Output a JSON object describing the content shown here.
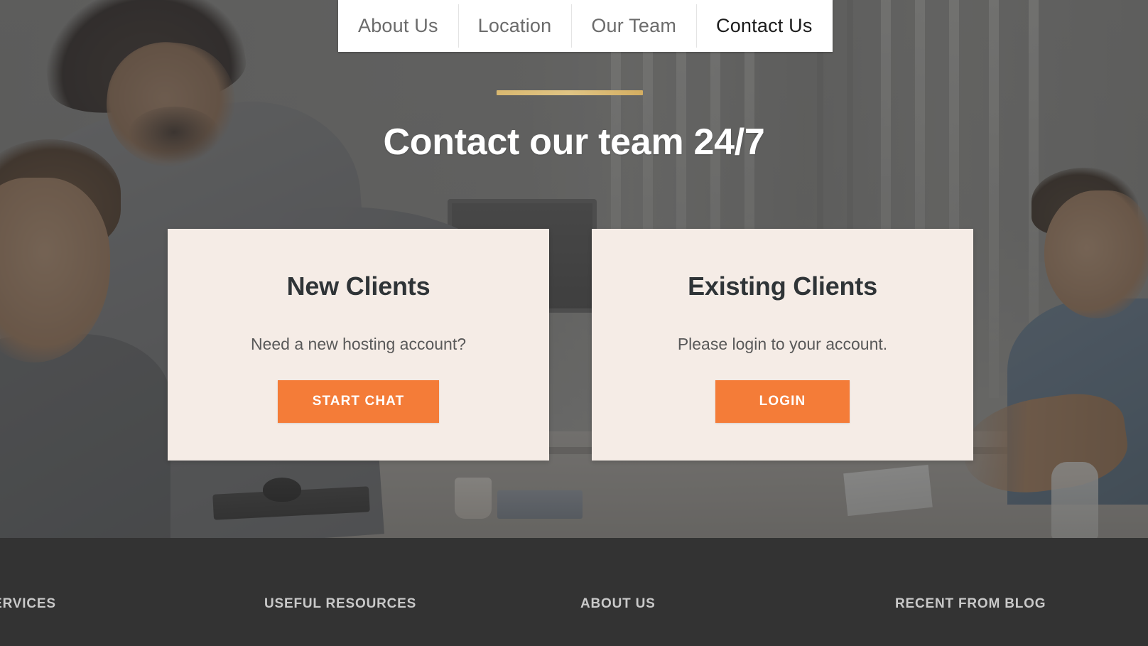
{
  "nav": {
    "tabs": [
      {
        "label": "About Us",
        "active": false
      },
      {
        "label": "Location",
        "active": false
      },
      {
        "label": "Our Team",
        "active": false
      },
      {
        "label": "Contact Us",
        "active": true
      }
    ]
  },
  "hero": {
    "title": "Contact our team 24/7",
    "accent_rule_color": "#d9b870",
    "overlay_color": "#383838"
  },
  "cards": [
    {
      "title": "New Clients",
      "subtitle": "Need a new hosting account?",
      "button_label": "START CHAT",
      "button_color": "#f47c38",
      "background": "#f5ece6"
    },
    {
      "title": "Existing Clients",
      "subtitle": "Please login to your account.",
      "button_label": "LOGIN",
      "button_color": "#f47c38",
      "background": "#f5ece6"
    }
  ],
  "footer": {
    "background": "#333333",
    "columns": [
      {
        "heading": "G SERVICES"
      },
      {
        "heading": "USEFUL RESOURCES"
      },
      {
        "heading": "ABOUT US"
      },
      {
        "heading": "RECENT FROM BLOG"
      }
    ]
  }
}
